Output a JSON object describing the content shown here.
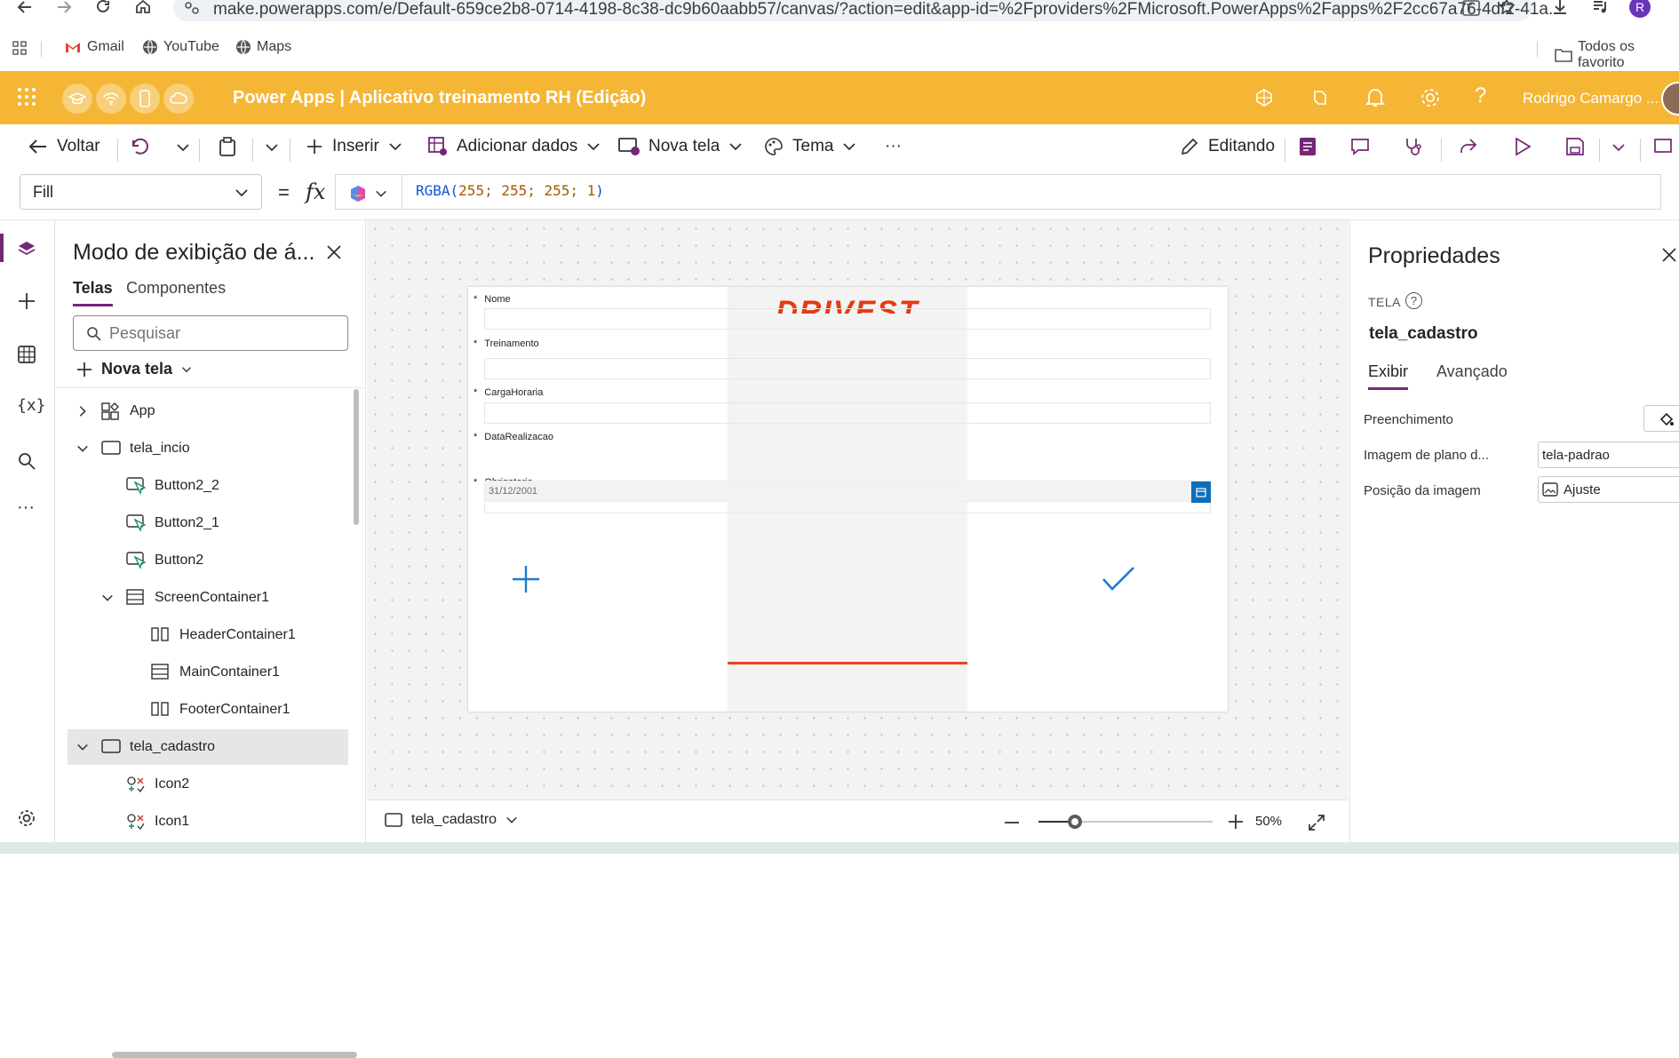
{
  "browser": {
    "url": "make.powerapps.com/e/Default-659ce2b8-0714-4198-8c38-dc9b60aabb57/canvas/?action=edit&app-id=%2Fproviders%2FMicrosoft.PowerApps%2Fapps%2F2cc67a76-4df2-41a...",
    "bookmarks": [
      "Gmail",
      "YouTube",
      "Maps"
    ],
    "bookmarks_right": "Todos os favorito",
    "profile_initial": "R"
  },
  "header": {
    "title": "Power Apps  |  Aplicativo treinamento RH (Edição)",
    "user": "Rodrigo Camargo ...",
    "accent": "#f4b634"
  },
  "commands": {
    "back": "Voltar",
    "insert": "Inserir",
    "add_data": "Adicionar dados",
    "new_screen": "Nova tela",
    "theme": "Tema",
    "more": "···",
    "editing": "Editando"
  },
  "formula": {
    "property": "Fill",
    "equals": "=",
    "fx": "fx",
    "expr_fn": "RGBA(",
    "expr_args": "255; 255; 255; 1",
    "expr_end": ")"
  },
  "rail": {
    "more": "···"
  },
  "tree": {
    "title": "Modo de exibição de á...",
    "tabs": [
      "Telas",
      "Componentes"
    ],
    "search_placeholder": "Pesquisar",
    "new_screen": "Nova tela",
    "nodes": [
      {
        "label": "App",
        "icon": "app-icon"
      },
      {
        "label": "tela_incio",
        "icon": "screen-icon"
      },
      {
        "label": "Button2_2",
        "icon": "button-icon"
      },
      {
        "label": "Button2_1",
        "icon": "button-icon"
      },
      {
        "label": "Button2",
        "icon": "button-icon"
      },
      {
        "label": "ScreenContainer1",
        "icon": "container-icon"
      },
      {
        "label": "HeaderContainer1",
        "icon": "horizontal-container-icon"
      },
      {
        "label": "MainContainer1",
        "icon": "container-icon"
      },
      {
        "label": "FooterContainer1",
        "icon": "horizontal-container-icon"
      },
      {
        "label": "tela_cadastro",
        "icon": "screen-icon"
      },
      {
        "label": "Icon2",
        "icon": "icon-control-icon"
      },
      {
        "label": "Icon1",
        "icon": "icon-control-icon"
      }
    ]
  },
  "canvas": {
    "logo": "DRIVEST",
    "logo_color": "#e63a10",
    "fields": [
      {
        "label": "Nome",
        "required": "*"
      },
      {
        "label": "Treinamento",
        "required": "*"
      },
      {
        "label": "CargaHoraria",
        "required": "*"
      },
      {
        "label": "DataRealizacao",
        "required": "*"
      },
      {
        "label": "Obrigatorio",
        "required": "*"
      }
    ],
    "date_value": "31/12/2001"
  },
  "footer": {
    "screen": "tela_cadastro",
    "zoom": "50%",
    "zoom_level": 0.5
  },
  "properties": {
    "title": "Propriedades",
    "kind": "TELA",
    "name": "tela_cadastro",
    "tabs": [
      "Exibir",
      "Avançado"
    ],
    "rows": [
      {
        "label": "Preenchimento"
      },
      {
        "label": "Imagem de plano d...",
        "value": "tela-padrao"
      },
      {
        "label": "Posição da imagem",
        "value": "Ajuste"
      }
    ]
  }
}
